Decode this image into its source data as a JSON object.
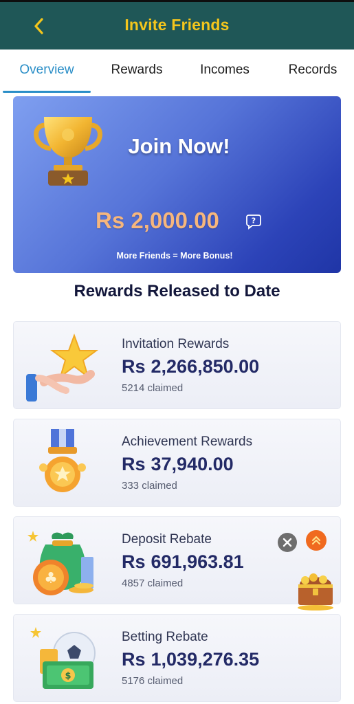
{
  "header": {
    "title": "Invite Friends",
    "back_icon": "chevron-left-icon",
    "accent": "#f4c61c",
    "bg": "#1f5757"
  },
  "tabs": [
    {
      "label": "Overview",
      "active": true
    },
    {
      "label": "Rewards",
      "active": false
    },
    {
      "label": "Incomes",
      "active": false
    },
    {
      "label": "Records",
      "active": false
    }
  ],
  "banner": {
    "title": "Join Now!",
    "amount": "Rs 2,000.00",
    "subtitle": "More Friends = More Bonus!",
    "icon": "trophy-icon",
    "help_icon": "help-chat-icon"
  },
  "section_title": "Rewards Released to Date",
  "cards": [
    {
      "label": "Invitation Rewards",
      "currency": "Rs",
      "amount": "2,266,850.00",
      "claimed": "5214 claimed",
      "icon": "hand-star-icon"
    },
    {
      "label": "Achievement Rewards",
      "currency": "Rs",
      "amount": "37,940.00",
      "claimed": "333 claimed",
      "icon": "medal-icon"
    },
    {
      "label": "Deposit Rebate",
      "currency": "Rs",
      "amount": "691,963.81",
      "claimed": "4857 claimed",
      "icon": "money-bag-icon"
    },
    {
      "label": "Betting Rebate",
      "currency": "Rs",
      "amount": "1,039,276.35",
      "claimed": "5176 claimed",
      "icon": "football-cash-icon"
    }
  ],
  "floating": {
    "close_icon": "close-icon",
    "up_icon": "double-chevron-up-icon",
    "chest_icon": "treasure-chest-icon"
  }
}
